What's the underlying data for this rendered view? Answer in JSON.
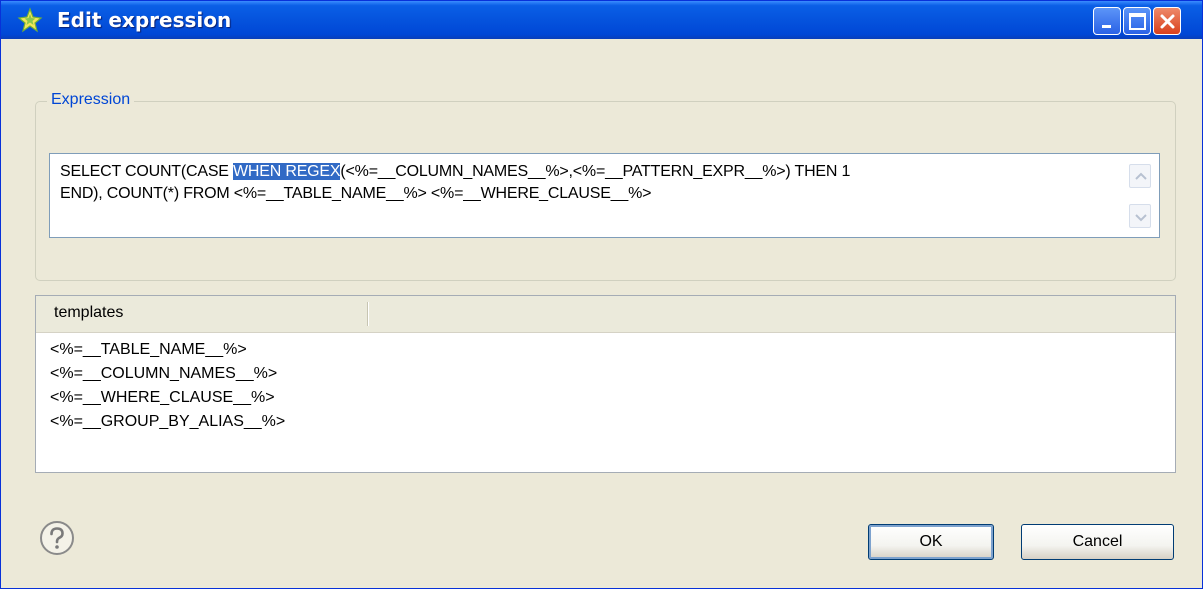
{
  "window": {
    "title": "Edit expression",
    "icon": "star-sparkle-icon",
    "controls": [
      "minimize",
      "maximize",
      "close"
    ]
  },
  "expression": {
    "group_label": "Expression",
    "text_before": "SELECT COUNT(CASE ",
    "selected_text": "WHEN REGEX",
    "text_after_line1": "(<%=__COLUMN_NAMES__%>,<%=__PATTERN_EXPR__%>) THEN 1",
    "line2": "END), COUNT(*) FROM <%=__TABLE_NAME__%> <%=__WHERE_CLAUSE__%>"
  },
  "templates": {
    "header": "templates",
    "items": [
      "<%=__TABLE_NAME__%>",
      "<%=__COLUMN_NAMES__%>",
      "<%=__WHERE_CLAUSE__%>",
      "<%=__GROUP_BY_ALIAS__%>"
    ]
  },
  "footer": {
    "help_icon": "question-icon",
    "ok_label": "OK",
    "cancel_label": "Cancel"
  },
  "colors": {
    "titlebar": "#0553DD",
    "selection": "#316AC5",
    "group_label": "#0046D5",
    "close_button": "#D9401D"
  }
}
